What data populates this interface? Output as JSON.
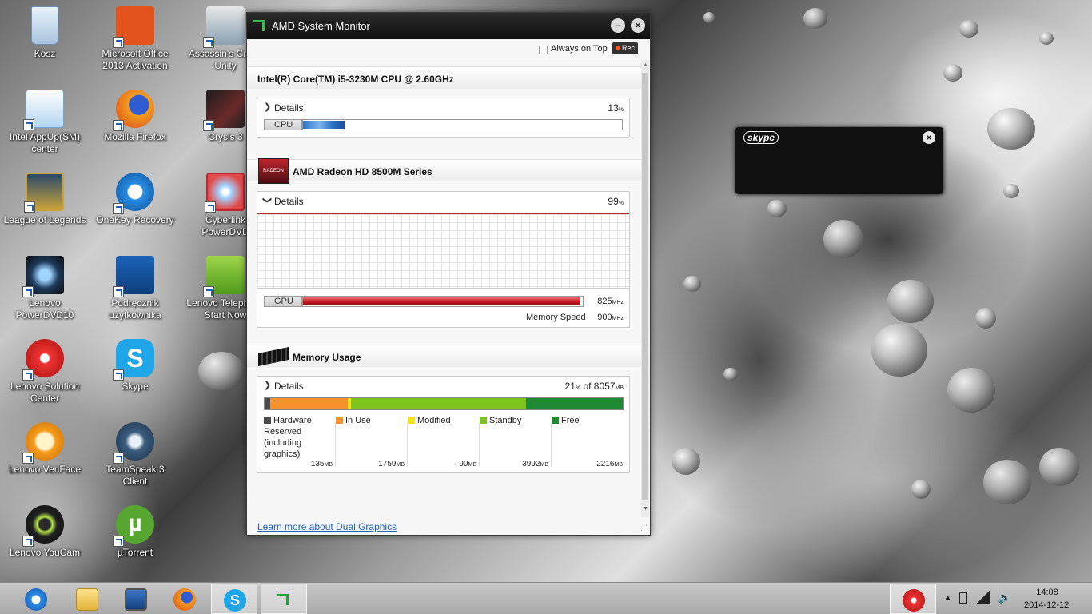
{
  "desktop": {
    "icons": [
      {
        "label": "Kosz"
      },
      {
        "label": "Microsoft Office 2013 Activation"
      },
      {
        "label": "Assassin's Creed Unity"
      },
      {
        "label": "Intel AppUp(SM) center"
      },
      {
        "label": "Mozilla Firefox"
      },
      {
        "label": "Crysis 3"
      },
      {
        "label": "League of Legends"
      },
      {
        "label": "OneKey Recovery"
      },
      {
        "label": "Cyberlink PowerDVD"
      },
      {
        "label": "Lenovo PowerDVD10"
      },
      {
        "label": "Podręcznik użytkownika"
      },
      {
        "label": "Lenovo Telephony Start Now"
      },
      {
        "label": "Lenovo Solution Center"
      },
      {
        "label": "Skype"
      },
      {
        "label": "Lenovo VeriFace"
      },
      {
        "label": "TeamSpeak 3 Client"
      },
      {
        "label": "Lenovo YouCam"
      },
      {
        "label": "µTorrent"
      }
    ]
  },
  "amd": {
    "title": "AMD System Monitor",
    "always_on_top": "Always on Top",
    "rec": "Rec",
    "cpu": {
      "name": "Intel(R) Core(TM) i5-3230M CPU @ 2.60GHz",
      "details": "Details",
      "percent": "13",
      "unit": "%",
      "bar_label": "CPU",
      "load": 0.13
    },
    "gpu": {
      "name": "AMD Radeon HD 8500M Series",
      "badge": "RADEON",
      "details": "Details",
      "percent": "99",
      "unit": "%",
      "bar_label": "GPU",
      "load": 0.99,
      "clock": "825",
      "clock_unit": "MHz",
      "mem_speed_label": "Memory Speed",
      "mem_speed": "900",
      "mem_speed_unit": "MHz"
    },
    "memory": {
      "title": "Memory Usage",
      "details": "Details",
      "percent": "21",
      "percent_unit": "%",
      "of_text": "of 8057",
      "of_unit": "MB",
      "total_mb": 8057,
      "legend": [
        {
          "label": "Hardware Reserved (including graphics)",
          "value": "135",
          "mb": 135,
          "color": "#4a4a4a"
        },
        {
          "label": "In Use",
          "value": "1759",
          "mb": 1759,
          "color": "#f7912e"
        },
        {
          "label": "Modified",
          "value": "90",
          "mb": 90,
          "color": "#f5e31a"
        },
        {
          "label": "Standby",
          "value": "3992",
          "mb": 3992,
          "color": "#7ec41c"
        },
        {
          "label": "Free",
          "value": "2216",
          "mb": 2216,
          "color": "#1f8a34"
        }
      ],
      "unit": "MB"
    },
    "footer_link": "Learn more about Dual Graphics"
  },
  "skype_popup": {
    "logo": "skype",
    "close": "×"
  },
  "taskbar": {
    "time": "14:08",
    "date": "2014-12-12"
  }
}
